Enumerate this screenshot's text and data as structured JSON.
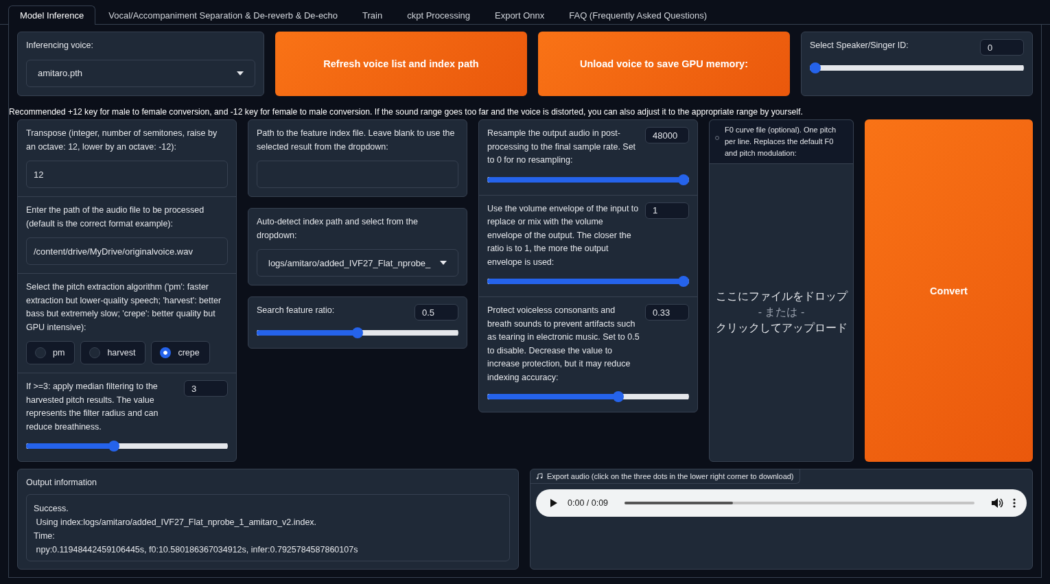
{
  "tabs": [
    {
      "label": "Model Inference",
      "selected": true
    },
    {
      "label": "Vocal/Accompaniment Separation & De-reverb & De-echo",
      "selected": false
    },
    {
      "label": "Train",
      "selected": false
    },
    {
      "label": "ckpt Processing",
      "selected": false
    },
    {
      "label": "Export Onnx",
      "selected": false
    },
    {
      "label": "FAQ (Frequently Asked Questions)",
      "selected": false
    }
  ],
  "top": {
    "voice": {
      "kind": "dropdown",
      "label": "Inferencing voice:",
      "value": "amitaro.pth"
    },
    "buttons": [
      "Refresh voice list and index path",
      "Unload voice to save GPU memory:"
    ],
    "speaker": {
      "kind": "slider",
      "label": "Select Speaker/Singer ID:",
      "value": "0",
      "level": 0
    }
  },
  "note": "Recommended +12 key for male to female conversion, and -12 key for female to male conversion. If the sound range goes too far and the voice is distorted, you can also adjust it to the appropriate range by yourself.",
  "columns": [
    {
      "cards": [
        {
          "blocks": [
            {
              "kind": "field",
              "label": "Transpose (integer, number of semitones, raise by an octave: 12, lower by an octave: -12):",
              "value": "12"
            },
            {
              "kind": "field",
              "label": "Enter the path of the audio file to be processed (default is the correct format example):",
              "value": "/content/drive/MyDrive/originalvoice.wav"
            },
            {
              "kind": "radio",
              "label": "Select the pitch extraction algorithm ('pm': faster extraction but lower-quality speech; 'harvest': better bass but extremely slow; 'crepe': better quality but GPU intensive):",
              "options": [
                {
                  "label": "pm",
                  "selected": false
                },
                {
                  "label": "harvest",
                  "selected": false
                },
                {
                  "label": "crepe",
                  "selected": true
                }
              ]
            },
            {
              "kind": "slider",
              "label": "If >=3: apply median filtering to the harvested pitch results. The value represents the filter radius and can reduce breathiness.",
              "value": "3",
              "level": 0.43
            }
          ]
        }
      ]
    },
    {
      "cards": [
        {
          "blocks": [
            {
              "kind": "field",
              "label": "Path to the feature index file. Leave blank to use the selected result from the dropdown:"
            }
          ]
        },
        {
          "blocks": [
            {
              "kind": "dropdown",
              "label": "Auto-detect index path and select from the dropdown:",
              "value": "logs/amitaro/added_IVF27_Flat_nprobe_"
            }
          ]
        },
        {
          "blocks": [
            {
              "kind": "slider",
              "label": "Search feature ratio:",
              "value": "0.5",
              "level": 0.5
            }
          ]
        }
      ]
    },
    {
      "cards": [
        {
          "blocks": [
            {
              "kind": "slider",
              "label": "Resample the output audio in post-processing to the final sample rate. Set to 0 for no resampling:",
              "value": "48000",
              "level": 1
            },
            {
              "kind": "slider",
              "label": "Use the volume envelope of the input to replace or mix with the volume envelope of the output. The closer the ratio is to 1, the more the output envelope is used:",
              "value": "1",
              "level": 1
            },
            {
              "kind": "slider",
              "label": "Protect voiceless consonants and breath sounds to prevent artifacts such as tearing in electronic music. Set to 0.5 to disable. Decrease the value to increase protection, but it may reduce indexing accuracy:",
              "value": "0.33",
              "level": 0.66
            }
          ]
        }
      ]
    }
  ],
  "upload": {
    "caption": "F0 curve file (optional). One pitch per line. Replaces the default F0 and pitch modulation:",
    "drop_text": "ここにファイルをドロップ",
    "or_text": "- または -",
    "click_text": "クリックしてアップロード"
  },
  "convert_button": "Convert",
  "output": {
    "label": "Output information",
    "text": "Success.\n Using index:logs/amitaro/added_IVF27_Flat_nprobe_1_amitaro_v2.index.\nTime:\n npy:0.11948442459106445s, f0:10.580186367034912s, infer:0.7925784587860107s"
  },
  "audio": {
    "label": "Export audio (click on the three dots in the lower right corner to download)",
    "time": "0:00 / 0:09",
    "level": 0.31
  }
}
